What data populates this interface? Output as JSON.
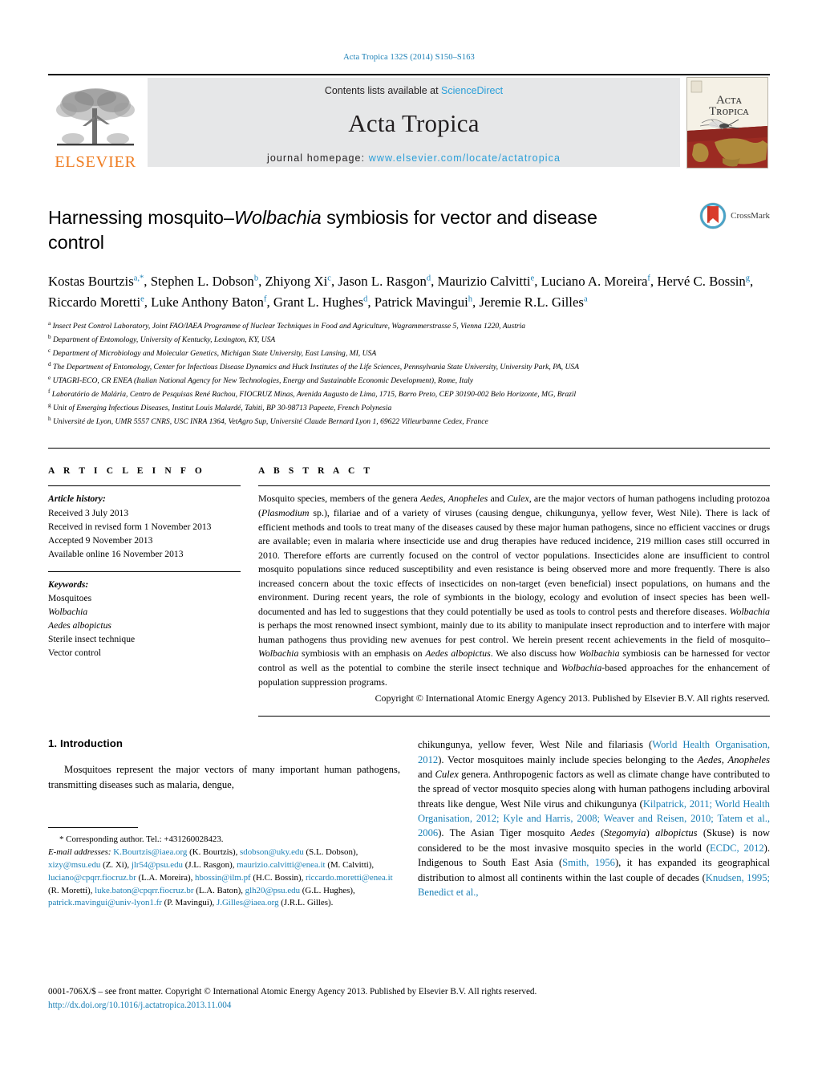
{
  "running_head": "Acta Tropica 132S (2014) S150–S163",
  "masthead": {
    "publisher_name": "ELSEVIER",
    "contents_prefix": "Contents lists available at ",
    "contents_link": "ScienceDirect",
    "journal_title": "Acta Tropica",
    "homepage_prefix": "journal homepage: ",
    "homepage_url": "www.elsevier.com/locate/actatropica",
    "cover_title_line1": "ACTA",
    "cover_title_line2": "TROPICA",
    "link_color": "#2b9fd9",
    "elsevier_orange": "#ef7d22"
  },
  "article": {
    "title_part1": "Harnessing mosquito–",
    "title_italic": "Wolbachia",
    "title_part2": " symbiosis for vector and disease control",
    "crossmark_label": "CrossMark",
    "authors_html": "Kostas Bourtzis<sup>a,*</sup>, Stephen L. Dobson<sup>b</sup>, Zhiyong Xi<sup>c</sup>, Jason L. Rasgon<sup>d</sup>, Maurizio Calvitti<sup>e</sup>, Luciano A. Moreira<sup>f</sup>, Hervé C. Bossin<sup>g</sup>, Riccardo Moretti<sup>e</sup>, Luke Anthony Baton<sup>f</sup>, Grant L. Hughes<sup>d</sup>, Patrick Mavingui<sup>h</sup>, Jeremie R.L. Gilles<sup>a</sup>",
    "affiliations": [
      {
        "mark": "a",
        "text": "Insect Pest Control Laboratory, Joint FAO/IAEA Programme of Nuclear Techniques in Food and Agriculture, Wagrammerstrasse 5, Vienna 1220, Austria"
      },
      {
        "mark": "b",
        "text": "Department of Entomology, University of Kentucky, Lexington, KY, USA"
      },
      {
        "mark": "c",
        "text": "Department of Microbiology and Molecular Genetics, Michigan State University, East Lansing, MI, USA"
      },
      {
        "mark": "d",
        "text": "The Department of Entomology, Center for Infectious Disease Dynamics and Huck Institutes of the Life Sciences, Pennsylvania State University, University Park, PA, USA"
      },
      {
        "mark": "e",
        "text": "UTAGRI-ECO, CR ENEA (Italian National Agency for New Technologies, Energy and Sustainable Economic Development), Rome, Italy"
      },
      {
        "mark": "f",
        "text": "Laboratório de Malária, Centro de Pesquisas René Rachou, FIOCRUZ Minas, Avenida Augusto de Lima, 1715, Barro Preto, CEP 30190-002 Belo Horizonte, MG, Brazil"
      },
      {
        "mark": "g",
        "text": "Unit of Emerging Infectious Diseases, Institut Louis Malardé, Tahiti, BP 30-98713 Papeete, French Polynesia"
      },
      {
        "mark": "h",
        "text": "Université de Lyon, UMR 5557 CNRS, USC INRA 1364, VetAgro Sup, Université Claude Bernard Lyon 1, 69622 Villeurbanne Cedex, France"
      }
    ]
  },
  "article_info": {
    "heading": "A R T I C L E   I N F O",
    "history_label": "Article history:",
    "history": [
      "Received 3 July 2013",
      "Received in revised form 1 November 2013",
      "Accepted 9 November 2013",
      "Available online 16 November 2013"
    ],
    "keywords_label": "Keywords:",
    "keywords": [
      {
        "text": "Mosquitoes",
        "italic": false
      },
      {
        "text": "Wolbachia",
        "italic": true
      },
      {
        "text": "Aedes albopictus",
        "italic": true
      },
      {
        "text": "Sterile insect technique",
        "italic": false
      },
      {
        "text": "Vector control",
        "italic": false
      }
    ]
  },
  "abstract": {
    "heading": "A B S T R A C T",
    "body_html": "Mosquito species, members of the genera <em>Aedes</em>, <em>Anopheles</em> and <em>Culex</em>, are the major vectors of human pathogens including protozoa (<em>Plasmodium</em> sp.), filariae and of a variety of viruses (causing dengue, chikungunya, yellow fever, West Nile). There is lack of efficient methods and tools to treat many of the diseases caused by these major human pathogens, since no efficient vaccines or drugs are available; even in malaria where insecticide use and drug therapies have reduced incidence, 219 million cases still occurred in 2010. Therefore efforts are currently focused on the control of vector populations. Insecticides alone are insufficient to control mosquito populations since reduced susceptibility and even resistance is being observed more and more frequently. There is also increased concern about the toxic effects of insecticides on non-target (even beneficial) insect populations, on humans and the environment. During recent years, the role of symbionts in the biology, ecology and evolution of insect species has been well-documented and has led to suggestions that they could potentially be used as tools to control pests and therefore diseases. <em>Wolbachia</em> is perhaps the most renowned insect symbiont, mainly due to its ability to manipulate insect reproduction and to interfere with major human pathogens thus providing new avenues for pest control. We herein present recent achievements in the field of mosquito–<em>Wolbachia</em> symbiosis with an emphasis on <em>Aedes albopictus</em>. We also discuss how <em>Wolbachia</em> symbiosis can be harnessed for vector control as well as the potential to combine the sterile insect technique and <em>Wolbachia</em>-based approaches for the enhancement of population suppression programs.",
    "copyright": "Copyright © International Atomic Energy Agency 2013. Published by Elsevier B.V. All rights reserved."
  },
  "introduction": {
    "heading": "1.  Introduction",
    "left_para_html": "Mosquitoes represent the major vectors of many important human pathogens, transmitting diseases such as malaria, dengue,",
    "right_para_html": "chikungunya, yellow fever, West Nile and filariasis (<span class=\"lnk\">World Health Organisation, 2012</span>). Vector mosquitoes mainly include species belonging to the <em>Aedes</em>, <em>Anopheles</em> and <em>Culex</em> genera. Anthropogenic factors as well as climate change have contributed to the spread of vector mosquito species along with human pathogens including arboviral threats like dengue, West Nile virus and chikungunya (<span class=\"lnk\">Kilpatrick, 2011; World Health Organisation, 2012; Kyle and Harris, 2008; Weaver and Reisen, 2010; Tatem et al., 2006</span>). The Asian Tiger mosquito <em>Aedes</em> (<em>Stegomyia</em>) <em>albopictus</em> (Skuse) is now considered to be the most invasive mosquito species in the world (<span class=\"lnk\">ECDC, 2012</span>). Indigenous to South East Asia (<span class=\"lnk\">Smith, 1956</span>), it has expanded its geographical distribution to almost all continents within the last couple of decades (<span class=\"lnk\">Knudsen, 1995; Benedict et al.,</span>"
  },
  "footnote": {
    "corresponding_html": "<span class=\"ind\">*</span>  Corresponding author. Tel.: +431260028423.",
    "emails_html": "<span class=\"lbl\">E-mail addresses:</span> <span class=\"lnk\">K.Bourtzis@iaea.org</span> (K. Bourtzis), <span class=\"lnk\">sdobson@uky.edu</span> (S.L. Dobson), <span class=\"lnk\">xizy@msu.edu</span> (Z. Xi), <span class=\"lnk\">jlr54@psu.edu</span> (J.L. Rasgon), <span class=\"lnk\">maurizio.calvitti@enea.it</span> (M. Calvitti), <span class=\"lnk\">luciano@cpqrr.fiocruz.br</span> (L.A. Moreira), <span class=\"lnk\">hbossin@ilm.pf</span> (H.C. Bossin), <span class=\"lnk\">riccardo.moretti@enea.it</span> (R. Moretti), <span class=\"lnk\">luke.baton@cpqrr.fiocruz.br</span> (L.A. Baton), <span class=\"lnk\">glh20@psu.edu</span> (G.L. Hughes), <span class=\"lnk\">patrick.mavingui@univ-lyon1.fr</span> (P. Mavingui), <span class=\"lnk\">J.Gilles@iaea.org</span> (J.R.L. Gilles)."
  },
  "footer": {
    "issn_line": "0001-706X/$ – see front matter. Copyright © International Atomic Energy Agency 2013. Published by Elsevier B.V. All rights reserved.",
    "doi": "http://dx.doi.org/10.1016/j.actatropica.2013.11.004"
  }
}
